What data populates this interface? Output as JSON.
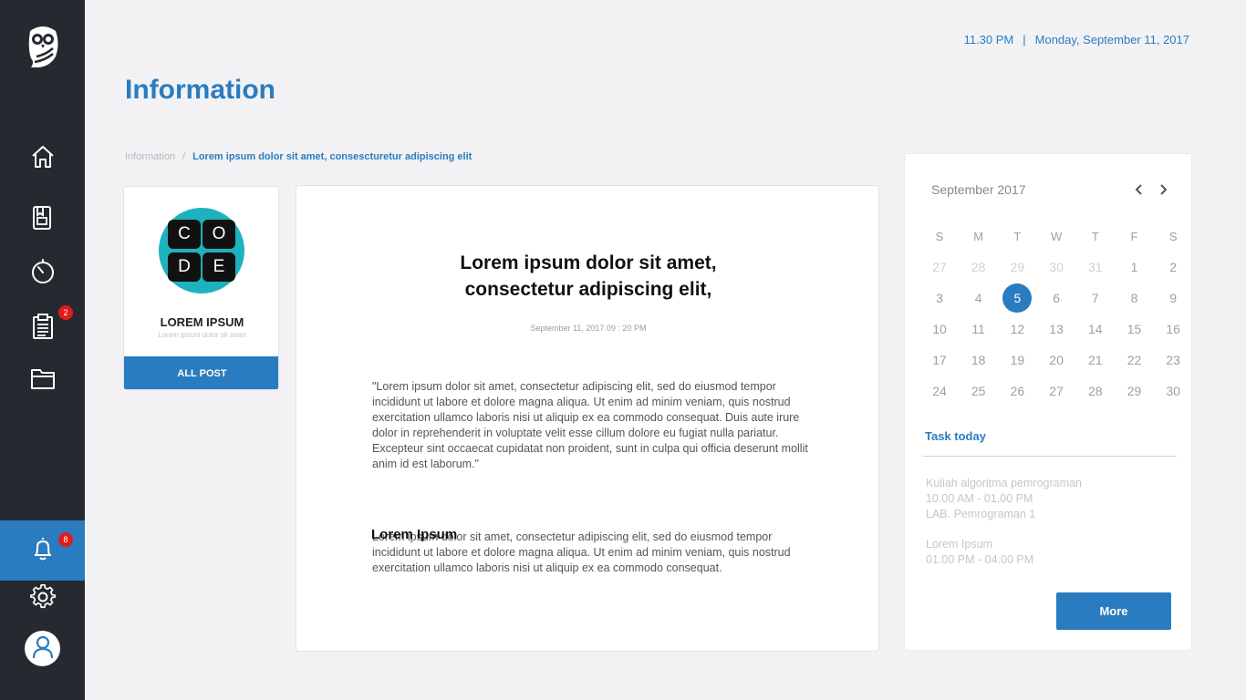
{
  "header": {
    "time": "11.30 PM",
    "separator": "|",
    "date": "Monday, September 11, 2017",
    "page_title": "Information"
  },
  "sidebar": {
    "items": [
      {
        "icon": "home-icon"
      },
      {
        "icon": "book-icon"
      },
      {
        "icon": "timer-icon"
      },
      {
        "icon": "clipboard-icon",
        "badge": "2"
      },
      {
        "icon": "folder-icon"
      },
      {
        "icon": "bell-icon",
        "badge": "8",
        "active": true
      },
      {
        "icon": "gear-icon"
      },
      {
        "icon": "user-icon"
      }
    ],
    "accent": "#2a7cc0",
    "background": "#252930"
  },
  "breadcrumb": {
    "root": "Information",
    "separator": "/",
    "current": "Lorem ipsum dolor sit amet, consescturetur adipiscing elit"
  },
  "profile": {
    "logo_letters": [
      "C",
      "O",
      "D",
      "E"
    ],
    "name": "LOREM IPSUM",
    "subtitle": "Lorem ipsum dolor sit amet",
    "button_label": "ALL POST"
  },
  "article": {
    "title": "Lorem ipsum dolor sit amet, consectetur adipiscing elit,",
    "date": "September 11, 2017 09 : 20 PM",
    "paragraph1": "\"Lorem ipsum dolor sit amet, consectetur adipiscing elit, sed do eiusmod tempor incididunt ut labore et dolore magna aliqua. Ut enim ad minim veniam, quis nostrud exercitation ullamco laboris nisi ut aliquip ex ea commodo consequat. Duis aute irure dolor in reprehenderit in voluptate velit esse cillum dolore eu fugiat nulla pariatur. Excepteur sint occaecat cupidatat non proident, sunt in culpa qui officia deserunt mollit anim id est laborum.\"",
    "section_heading": "Lorem Ipsum",
    "paragraph2": "Lorem ipsum dolor sit amet, consectetur adipiscing elit, sed do eiusmod tempor incididunt ut labore et dolore magna aliqua. Ut enim ad minim veniam, quis nostrud exercitation ullamco laboris nisi ut aliquip ex ea commodo consequat."
  },
  "calendar": {
    "month_label": "September 2017",
    "weekdays": [
      "S",
      "M",
      "T",
      "W",
      "T",
      "F",
      "S"
    ],
    "weeks": [
      [
        "27",
        "28",
        "29",
        "30",
        "31",
        "1",
        "2"
      ],
      [
        "3",
        "4",
        "5",
        "6",
        "7",
        "8",
        "9"
      ],
      [
        "10",
        "11",
        "12",
        "13",
        "14",
        "15",
        "16"
      ],
      [
        "17",
        "18",
        "19",
        "20",
        "21",
        "22",
        "23"
      ],
      [
        "24",
        "25",
        "26",
        "27",
        "28",
        "29",
        "30"
      ]
    ],
    "other_month_cells": 5,
    "selected_day": "5"
  },
  "tasks": {
    "title": "Task today",
    "items": [
      {
        "name": "Kuliah algoritma pemrograman",
        "time": "10.00 AM - 01.00 PM",
        "place": "LAB. Pemrograman 1"
      },
      {
        "name": "Lorem Ipsum",
        "time": "01.00 PM - 04.00 PM"
      }
    ],
    "more_label": "More"
  }
}
